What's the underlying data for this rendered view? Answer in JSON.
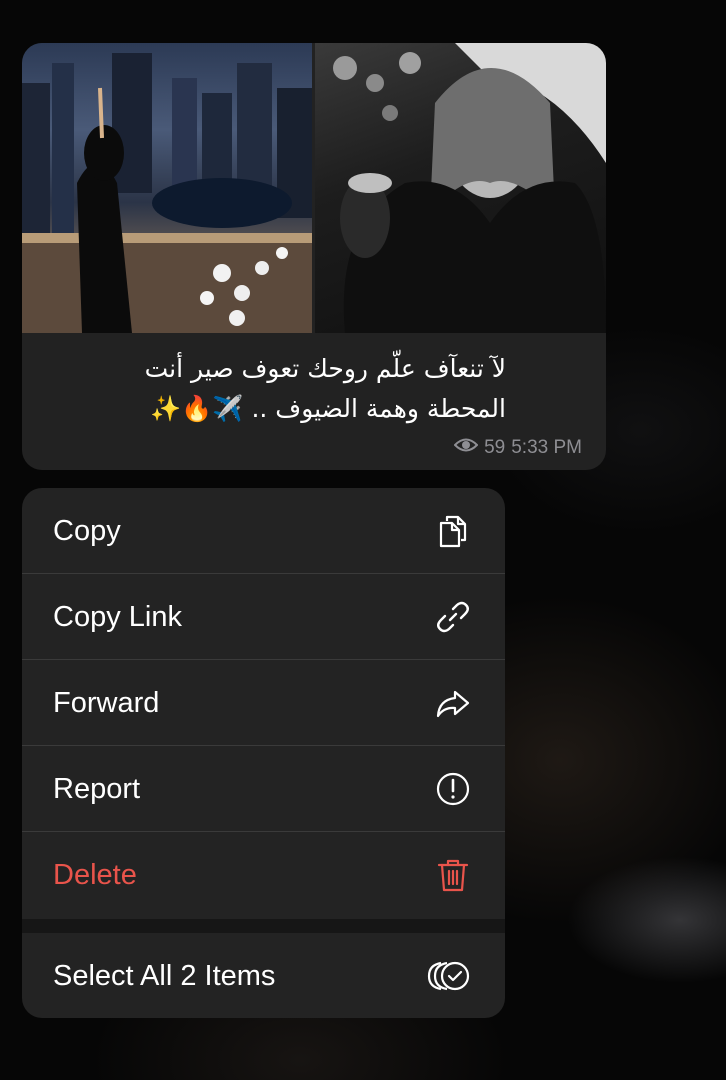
{
  "message": {
    "caption_line1": "لآ تنعآف علّم روحك تعوف صير أنت",
    "caption_line2": "المحطة وهمة الضيوف .. ✈️🔥✨",
    "views": "59",
    "time": "5:33 PM",
    "photos": [
      {
        "name": "city-night-photo"
      },
      {
        "name": "fur-coat-photo"
      }
    ]
  },
  "menu": {
    "items": [
      {
        "label": "Copy",
        "icon": "copy-icon"
      },
      {
        "label": "Copy Link",
        "icon": "link-icon"
      },
      {
        "label": "Forward",
        "icon": "forward-icon"
      },
      {
        "label": "Report",
        "icon": "report-icon"
      },
      {
        "label": "Delete",
        "icon": "trash-icon",
        "color": "#e9544b"
      },
      {
        "label": "Select All 2 Items",
        "icon": "select-all-icon"
      }
    ]
  },
  "colors": {
    "bubble": "#222222",
    "menu": "#232323",
    "destructive": "#e9544b",
    "secondary_text": "#8e8e93"
  }
}
